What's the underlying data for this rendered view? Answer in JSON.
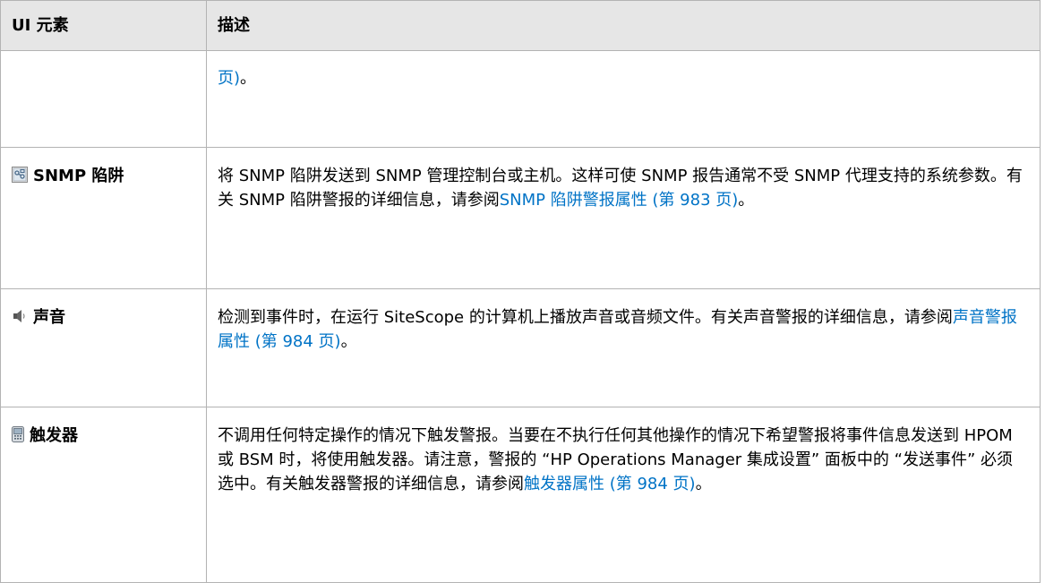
{
  "table": {
    "header": {
      "element": "UI 元素",
      "description": "描述"
    },
    "rows": [
      {
        "element": "",
        "icon": "",
        "description_text": "",
        "link": "页)",
        "suffix": "。"
      },
      {
        "element": "SNMP 陷阱",
        "icon": "snmp-trap-icon",
        "description_text": "将 SNMP 陷阱发送到 SNMP 管理控制台或主机。这样可使 SNMP 报告通常不受 SNMP 代理支持的系统参数。有关 SNMP 陷阱警报的详细信息，请参阅",
        "link": "SNMP 陷阱警报属性 (第 983 页)",
        "suffix": "。"
      },
      {
        "element": "声音",
        "icon": "speaker-icon",
        "description_text": "检测到事件时，在运行 SiteScope 的计算机上播放声音或音频文件。有关声音警报的详细信息，请参阅",
        "link": "声音警报属性 (第 984 页)",
        "suffix": "。"
      },
      {
        "element": "触发器",
        "icon": "trigger-device-icon",
        "description_text": "不调用任何特定操作的情况下触发警报。当要在不执行任何其他操作的情况下希望警报将事件信息发送到 HPOM 或 BSM 时，将使用触发器。请注意，警报的 “HP Operations Manager 集成设置” 面板中的 “发送事件” 必须选中。有关触发器警报的详细信息，请参阅",
        "link": "触发器属性 (第 984 页)",
        "suffix": "。"
      }
    ]
  },
  "colors": {
    "link": "#0073c6",
    "header_bg": "#e6e6e6",
    "border": "#b3b3b3"
  }
}
